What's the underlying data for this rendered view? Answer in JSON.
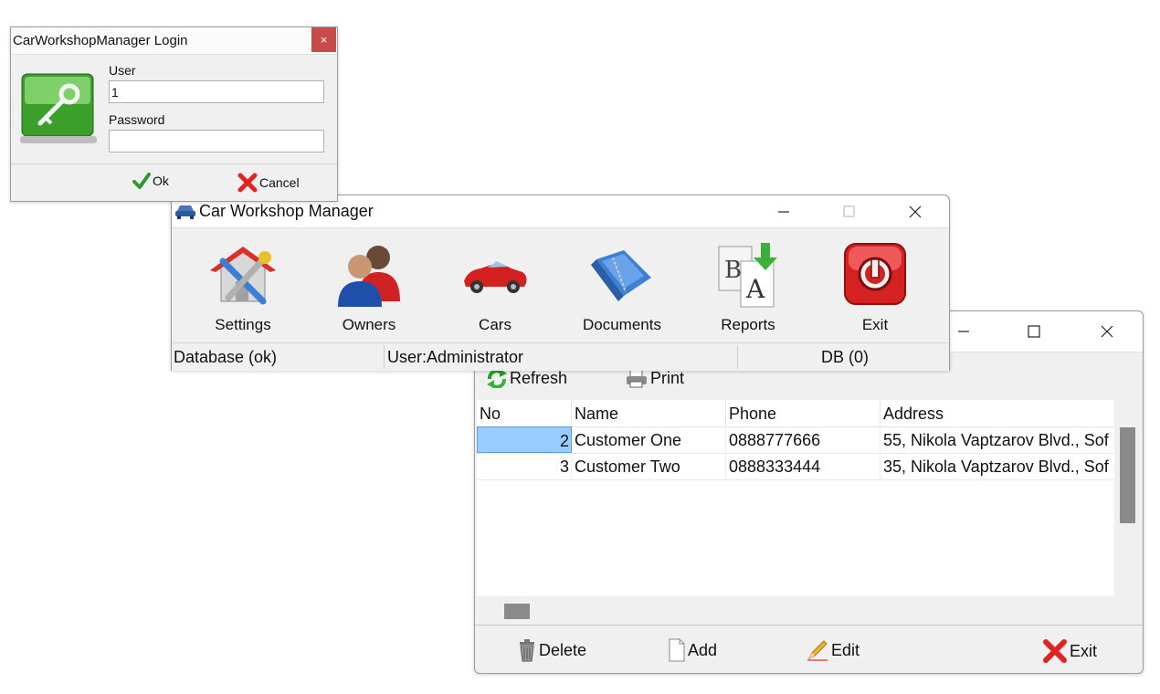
{
  "login": {
    "title": "CarWorkshopManager Login",
    "close_glyph": "×",
    "close_color": "#c94a4a",
    "user_label": "User",
    "user_value": "1",
    "password_label": "Password",
    "password_value": "",
    "ok_label": "Ok",
    "cancel_label": "Cancel",
    "icon": "key-icon"
  },
  "main": {
    "title": "Car Workshop Manager",
    "toolbar": [
      {
        "label": "Settings",
        "icon": "settings-icon"
      },
      {
        "label": "Owners",
        "icon": "owners-icon"
      },
      {
        "label": "Cars",
        "icon": "car-icon"
      },
      {
        "label": "Documents",
        "icon": "documents-icon"
      },
      {
        "label": "Reports",
        "icon": "reports-icon"
      },
      {
        "label": "Exit",
        "icon": "power-icon"
      }
    ],
    "status": {
      "database": "Database (ok)",
      "user": "User:Administrator",
      "db": "DB (0)"
    }
  },
  "customers": {
    "toolbar": {
      "refresh": "Refresh",
      "print": "Print"
    },
    "columns": [
      "No",
      "Name",
      "Phone",
      "Address"
    ],
    "rows": [
      {
        "no": "2",
        "name": "Customer One",
        "phone": "0888777666",
        "address": "55, Nikola Vaptzarov Blvd., Sof"
      },
      {
        "no": "3",
        "name": "Customer Two",
        "phone": "0888333444",
        "address": "35, Nikola Vaptzarov Blvd., Sof"
      }
    ],
    "buttons": {
      "delete": "Delete",
      "add": "Add",
      "edit": "Edit",
      "exit": "Exit"
    },
    "selection_color": "#99ccff"
  }
}
